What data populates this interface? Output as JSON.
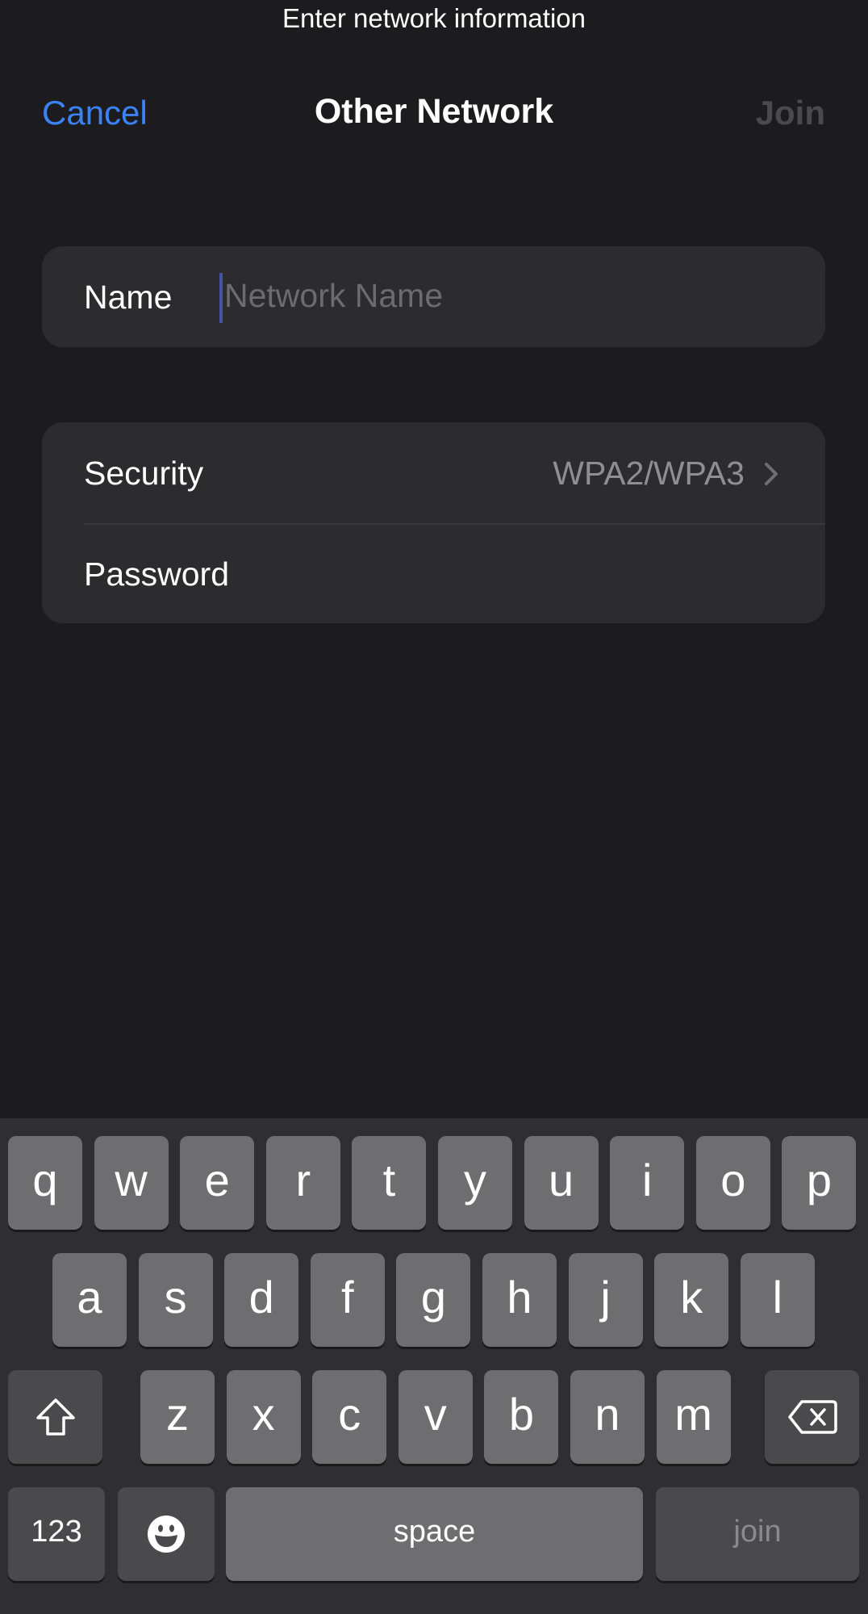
{
  "caption": "Enter network information",
  "nav": {
    "cancel_label": "Cancel",
    "title": "Other Network",
    "join_label": "Join"
  },
  "colors": {
    "accent": "#3b82f6",
    "background": "#1c1c1e",
    "card": "#2c2c2e",
    "disabled": "#4a4a4d",
    "secondary_text": "#8e8e93"
  },
  "name_field": {
    "label": "Name",
    "value": "",
    "placeholder": "Network Name"
  },
  "security": {
    "label": "Security",
    "value": "WPA2/WPA3"
  },
  "password": {
    "label": "Password"
  },
  "keyboard": {
    "row1": [
      "q",
      "w",
      "e",
      "r",
      "t",
      "y",
      "u",
      "i",
      "o",
      "p"
    ],
    "row2": [
      "a",
      "s",
      "d",
      "f",
      "g",
      "h",
      "j",
      "k",
      "l"
    ],
    "row3": [
      "z",
      "x",
      "c",
      "v",
      "b",
      "n",
      "m"
    ],
    "shift_icon": "shift-arrow-icon",
    "delete_icon": "backspace-icon",
    "numbers_label": "123",
    "emoji_icon": "emoji-smiley-icon",
    "space_label": "space",
    "join_label": "join"
  }
}
